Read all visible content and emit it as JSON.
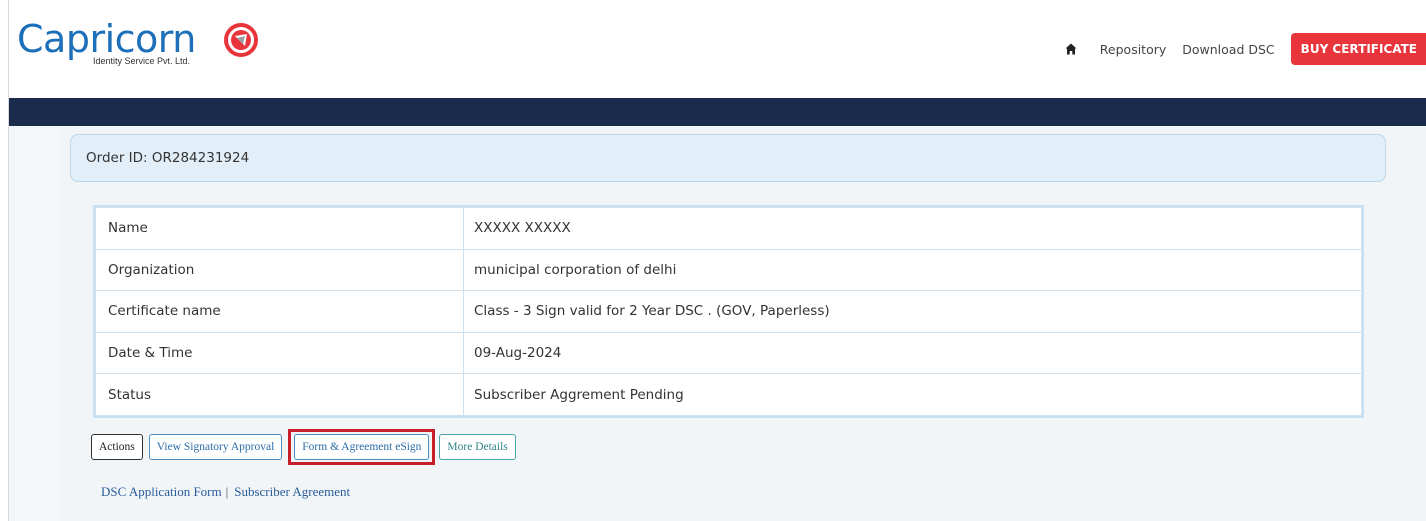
{
  "brand": {
    "name": "Capricorn",
    "tagline": "Identity Service Pvt. Ltd.",
    "color": "#1c6fb8"
  },
  "nav": {
    "home_icon": "home-icon",
    "links": [
      "Repository",
      "Download DSC"
    ],
    "buy_button": "BUY CERTIFICATE",
    "buy_color": "#e8353b"
  },
  "order": {
    "label": "Order ID: OR284231924"
  },
  "details": {
    "rows": [
      {
        "key": "Name",
        "value": "XXXXX XXXXX"
      },
      {
        "key": "Organization",
        "value": "municipal corporation of delhi"
      },
      {
        "key": "Certificate name",
        "value": "Class - 3 Sign valid for 2 Year DSC . (GOV, Paperless)"
      },
      {
        "key": "Date & Time",
        "value": "09-Aug-2024"
      },
      {
        "key": "Status",
        "value": "Subscriber Aggrement Pending"
      }
    ]
  },
  "actions": {
    "actions_label": "Actions",
    "view_signatory": "View Signatory Approval",
    "form_agreement": "Form & Agreement eSign",
    "more_details": "More Details"
  },
  "links": {
    "application_form": "DSC Application Form",
    "separator": "|",
    "subscriber_agreement": "Subscriber Agreement"
  },
  "colors": {
    "navbar": "#1a2b4c",
    "status_text": "#c0504d",
    "highlight": "#c81e2a"
  }
}
